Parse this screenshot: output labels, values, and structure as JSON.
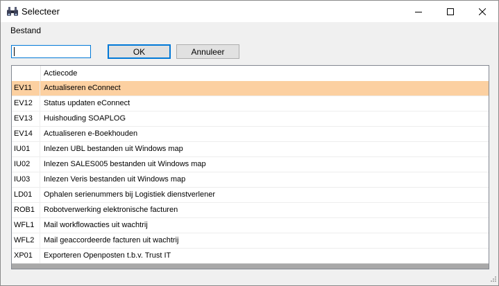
{
  "window": {
    "title": "Selecteer",
    "icon": "binoculars-icon"
  },
  "menu": {
    "items": [
      "Bestand"
    ]
  },
  "toolbar": {
    "search_value": "",
    "ok_label": "OK",
    "cancel_label": "Annuleer"
  },
  "grid": {
    "columns": [
      "",
      "Actiecode"
    ],
    "selected_index": 0,
    "selection_color": "#fcd0a1",
    "rows": [
      {
        "code": "EV11",
        "desc": "Actualiseren eConnect"
      },
      {
        "code": "EV12",
        "desc": "Status updaten eConnect"
      },
      {
        "code": "EV13",
        "desc": "Huishouding SOAPLOG"
      },
      {
        "code": "EV14",
        "desc": "Actualiseren e-Boekhouden"
      },
      {
        "code": "IU01",
        "desc": "Inlezen UBL bestanden uit Windows map"
      },
      {
        "code": "IU02",
        "desc": "Inlezen SALES005 bestanden uit Windows map"
      },
      {
        "code": "IU03",
        "desc": "Inlezen Veris bestanden uit Windows map"
      },
      {
        "code": "LD01",
        "desc": "Ophalen serienummers bij Logistiek dienstverlener"
      },
      {
        "code": "ROB1",
        "desc": "Robotverwerking elektronische facturen"
      },
      {
        "code": "WFL1",
        "desc": "Mail workflowacties uit wachtrij"
      },
      {
        "code": "WFL2",
        "desc": "Mail geaccordeerde facturen uit wachtrij"
      },
      {
        "code": "XP01",
        "desc": "Exporteren Openposten t.b.v. Trust IT"
      }
    ]
  }
}
